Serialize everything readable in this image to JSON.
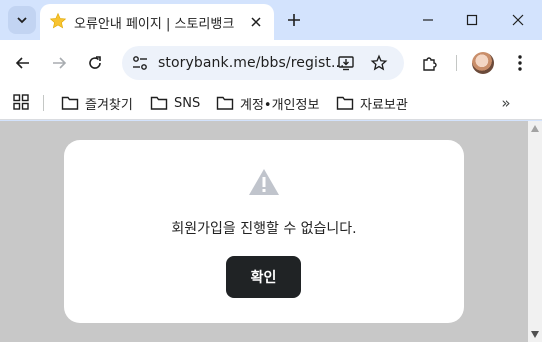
{
  "tab": {
    "title": "오류안내 페이지 | 스토리뱅크",
    "favicon": "star-icon"
  },
  "toolbar": {
    "url": "storybank.me/bbs/regist..."
  },
  "bookmarks": [
    {
      "label": "즐겨찾기",
      "icon": "folder-icon"
    },
    {
      "label": "SNS",
      "icon": "folder-icon"
    },
    {
      "label": "계정•개인정보",
      "icon": "folder-icon"
    },
    {
      "label": "자료보관",
      "icon": "folder-icon"
    }
  ],
  "bookmarks_more": "»",
  "modal": {
    "message": "회원가입을 진행할 수 없습니다.",
    "confirm_label": "확인"
  },
  "colors": {
    "tabstrip": "#d3e3fd",
    "overlay": "#c8c8c8",
    "button": "#202325",
    "warning_icon": "#c0c4cc"
  }
}
